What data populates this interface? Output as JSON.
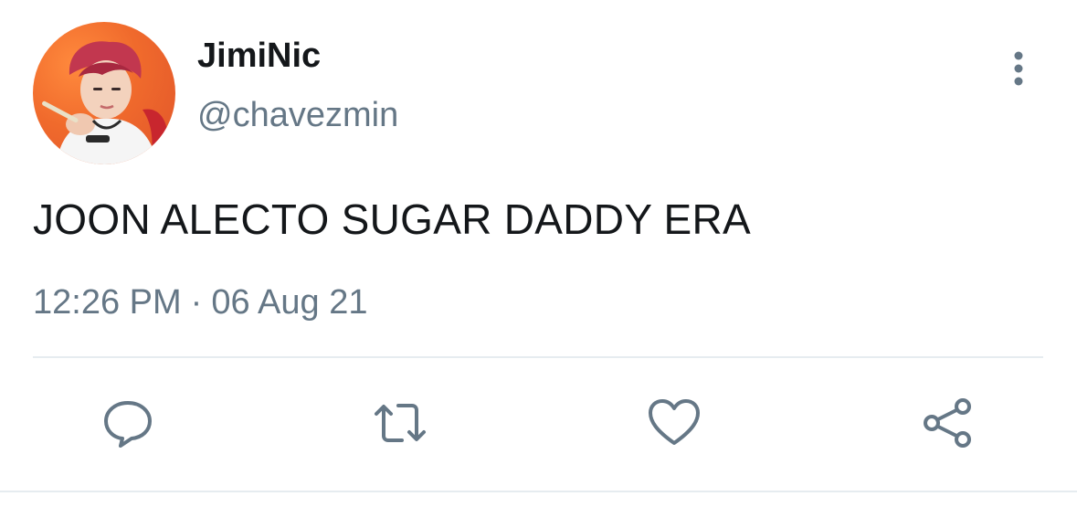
{
  "tweet": {
    "display_name": "JimiNic",
    "handle": "@chavezmin",
    "text": "JOON ALECTO SUGAR DADDY ERA",
    "time": "12:26 PM",
    "separator": "·",
    "date": "06 Aug 21"
  },
  "icons": {
    "more": "more-vertical-icon",
    "reply": "reply-icon",
    "retweet": "retweet-icon",
    "like": "heart-icon",
    "share": "share-icon"
  },
  "colors": {
    "text_primary": "#14171a",
    "text_secondary": "#657786",
    "icon": "#657786",
    "divider": "#e6ecf0",
    "avatar_bg": "#f06a2c"
  }
}
